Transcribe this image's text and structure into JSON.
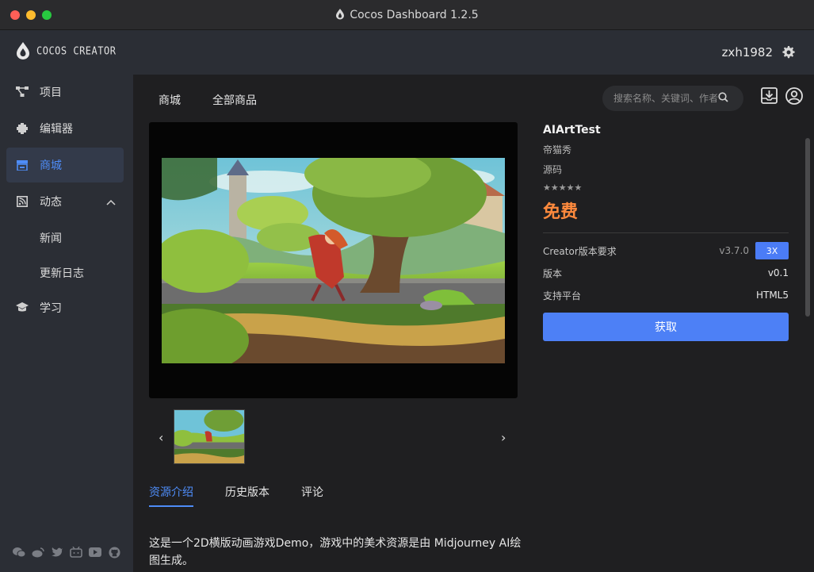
{
  "window": {
    "title": "Cocos Dashboard 1.2.5"
  },
  "brand": {
    "logo_text": "COCOS CREATOR"
  },
  "sidebar": {
    "items": [
      {
        "label": "项目",
        "icon": "project-icon"
      },
      {
        "label": "编辑器",
        "icon": "editor-icon"
      },
      {
        "label": "商城",
        "icon": "store-icon",
        "active": true
      },
      {
        "label": "动态",
        "icon": "news-feed-icon",
        "expanded": true
      },
      {
        "label": "新闻"
      },
      {
        "label": "更新日志"
      },
      {
        "label": "学习",
        "icon": "learn-icon"
      }
    ],
    "social_icons": [
      "wechat-icon",
      "weibo-icon",
      "twitter-icon",
      "bilibili-icon",
      "youtube-icon",
      "github-icon"
    ]
  },
  "header": {
    "username": "zxh1982"
  },
  "store": {
    "tabs": [
      "商城",
      "全部商品"
    ],
    "search_placeholder": "搜索名称、关键词、作者"
  },
  "product": {
    "title": "AIArtTest",
    "author": "帝猫秀",
    "type": "源码",
    "rating": 0,
    "stars": "★★★★★",
    "price": "免费",
    "creator_label": "Creator版本要求",
    "creator_version": "v3.7.0",
    "creator_badge": "3X",
    "version_label": "版本",
    "version": "v0.1",
    "platform_label": "支持平台",
    "platform": "HTML5",
    "get_button": "获取"
  },
  "gallery": {
    "prev": "‹",
    "next": "›"
  },
  "detail_tabs": [
    "资源介绍",
    "历史版本",
    "评论"
  ],
  "description": "这是一个2D横版动画游戏Demo，游戏中的美术资源是由 Midjourney AI绘图生成。",
  "colors": {
    "accent": "#4e8cf7",
    "price": "#ff8a3d",
    "button": "#4d80f6"
  }
}
